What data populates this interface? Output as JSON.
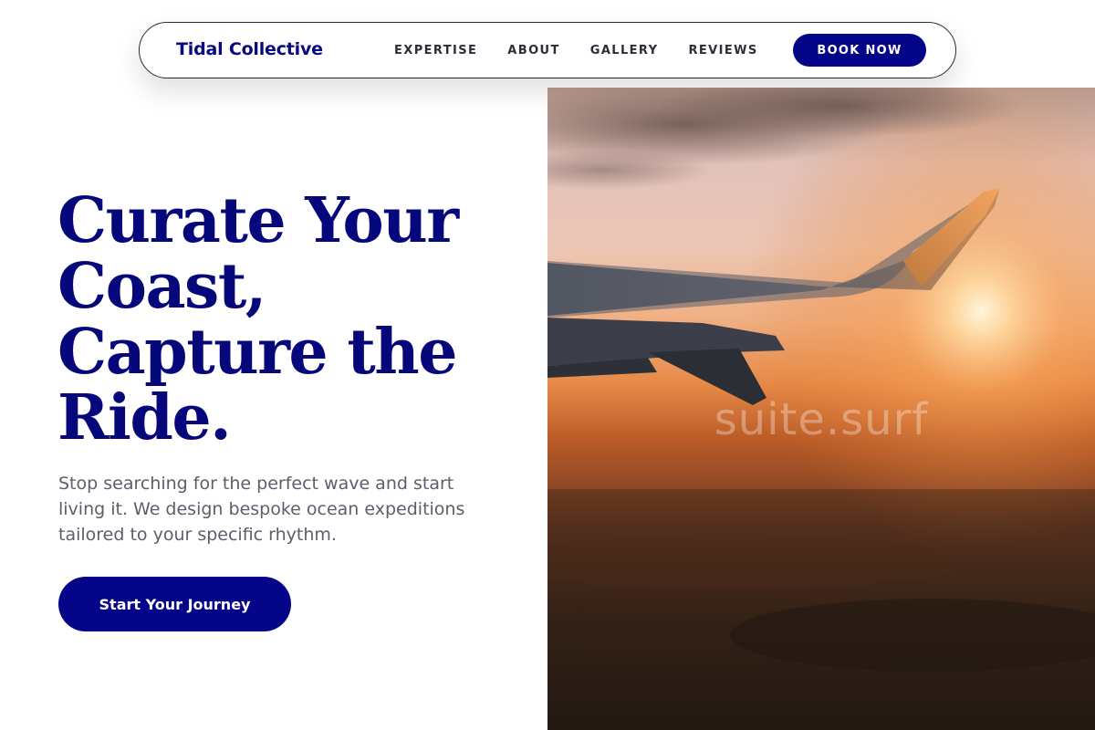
{
  "nav": {
    "brand": "Tidal Collective",
    "links": [
      "EXPERTISE",
      "ABOUT",
      "GALLERY",
      "REVIEWS"
    ],
    "cta": "BOOK NOW"
  },
  "hero": {
    "title_lines": [
      "Curate Your",
      "Coast,",
      "Capture the",
      "Ride."
    ],
    "subtitle": "Stop searching for the perfect wave and start living it. We design bespoke ocean expeditions tailored to your specific rhythm.",
    "cta": "Start Your Journey",
    "image_watermark": "suite.surf"
  },
  "colors": {
    "brand": "#05058a",
    "title": "#07077c",
    "body_text": "#5b5f6b"
  }
}
